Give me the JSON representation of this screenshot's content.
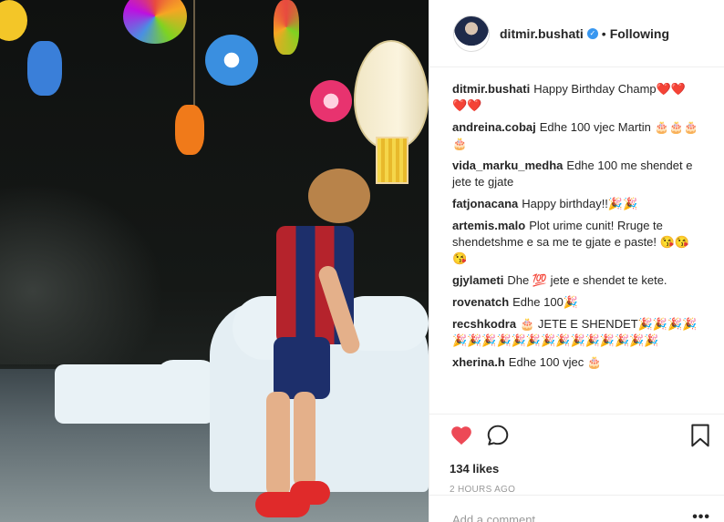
{
  "post": {
    "photo_alt": "photo",
    "header": {
      "username": "ditmir.bushati",
      "separator": "•",
      "follow_label": "Following"
    },
    "comments": [
      {
        "user": "ditmir.bushati",
        "text": "Happy Birthday Champ❤️❤️❤️❤️"
      },
      {
        "user": "andreina.cobaj",
        "text": "Edhe 100 vjec Martin 🎂🎂🎂🎂"
      },
      {
        "user": "vida_marku_medha",
        "text": "Edhe 100 me shendet e jete te gjate"
      },
      {
        "user": "fatjonacana",
        "text": "Happy birthday!!🎉🎉"
      },
      {
        "user": "artemis.malo",
        "text": "Plot urime cunit! Rruge te shendetshme e sa me te gjate e paste! 😘😘😘"
      },
      {
        "user": "gjylameti",
        "text": "Dhe 💯 jete e shendet te kete."
      },
      {
        "user": "rovenatch",
        "text": "Edhe 100🎉"
      },
      {
        "user": "recshkodra",
        "text": "🎂 JETE E SHENDET🎉🎉🎉🎉🎉🎉🎉🎉🎉🎉🎉🎉🎉🎉🎉🎉🎉🎉"
      },
      {
        "user": "xherina.h",
        "text": "Edhe 100 vjec 🎂"
      }
    ],
    "likes": "134 likes",
    "time": "2 HOURS AGO",
    "add_comment_placeholder": "Add a comment…",
    "more_label": "•••"
  },
  "colors": {
    "heart": "#ed4956",
    "verified": "#3897f0",
    "text": "#262626",
    "muted": "#999999"
  },
  "icons": {
    "like": "heart-icon",
    "comment": "comment-icon",
    "save": "bookmark-icon",
    "verified": "verified-badge-icon",
    "more": "more-options-icon"
  }
}
